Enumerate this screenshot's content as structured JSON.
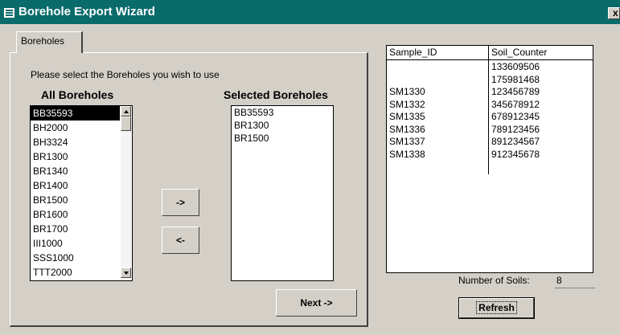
{
  "window": {
    "title": "Borehole Export Wizard",
    "close_label": "x"
  },
  "tab": {
    "label": "Boreholes"
  },
  "instructions": "Please select the Boreholes you wish to use",
  "all_boreholes": {
    "heading": "All Boreholes",
    "items": [
      "BB35593",
      "BH2000",
      "BH3324",
      "BR1300",
      "BR1340",
      "BR1400",
      "BR1500",
      "BR1600",
      "BR1700",
      "III1000",
      "SSS1000",
      "TTT2000"
    ],
    "selected": "BB35593"
  },
  "buttons": {
    "add": "->",
    "remove": "<-",
    "next": "Next ->",
    "refresh": "Refresh"
  },
  "selected_boreholes": {
    "heading": "Selected Boreholes",
    "items": [
      "BB35593",
      "BR1300",
      "BR1500"
    ]
  },
  "soils_table": {
    "columns": [
      "Sample_ID",
      "Soil_Counter"
    ],
    "rows": [
      [
        "",
        "133609506"
      ],
      [
        "",
        "175981468"
      ],
      [
        "SM1330",
        "123456789"
      ],
      [
        "SM1332",
        "345678912"
      ],
      [
        "SM1335",
        "678912345"
      ],
      [
        "SM1336",
        "789123456"
      ],
      [
        "SM1337",
        "891234567"
      ],
      [
        "SM1338",
        "912345678"
      ]
    ]
  },
  "soil_count": {
    "label": "Number of Soils:",
    "value": "8"
  }
}
